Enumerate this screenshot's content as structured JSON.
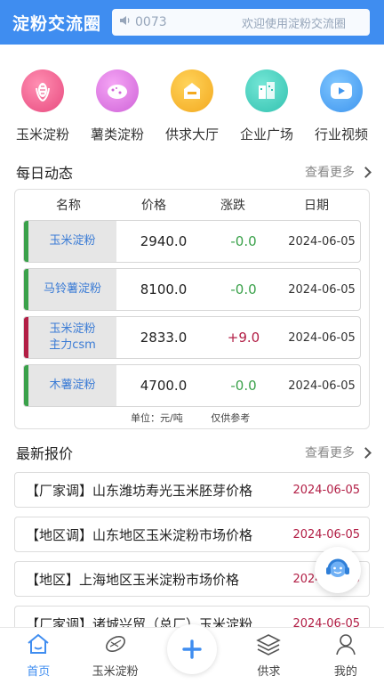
{
  "header": {
    "title": "淀粉交流圈",
    "notice_number": "0073",
    "notice_text": "欢迎使用淀粉交流圈"
  },
  "shortcuts": [
    {
      "label": "玉米淀粉",
      "icon": "corn-icon"
    },
    {
      "label": "薯类淀粉",
      "icon": "potato-icon"
    },
    {
      "label": "供求大厅",
      "icon": "hall-icon"
    },
    {
      "label": "企业广场",
      "icon": "buildings-icon"
    },
    {
      "label": "行业视频",
      "icon": "play-icon"
    }
  ],
  "daily": {
    "title": "每日动态",
    "more": "查看更多",
    "columns": [
      "名称",
      "价格",
      "涨跌",
      "日期"
    ],
    "rows": [
      {
        "name": "玉米淀粉",
        "price": "2940.0",
        "change": "-0.0",
        "date": "2024-06-05",
        "trend": "down"
      },
      {
        "name": "马铃薯淀粉",
        "price": "8100.0",
        "change": "-0.0",
        "date": "2024-06-05",
        "trend": "down"
      },
      {
        "name": "玉米淀粉\n主力csm",
        "name_line1": "玉米淀粉",
        "name_line2": "主力csm",
        "price": "2833.0",
        "change": "+9.0",
        "date": "2024-06-05",
        "trend": "up"
      },
      {
        "name": "木薯淀粉",
        "price": "4700.0",
        "change": "-0.0",
        "date": "2024-06-05",
        "trend": "down"
      }
    ],
    "unit": "单位：元/吨",
    "note": "仅供参考"
  },
  "quotes": {
    "title": "最新报价",
    "more": "查看更多",
    "items": [
      {
        "title": "【厂家调】山东潍坊寿光玉米胚芽价格",
        "date": "2024-06-05"
      },
      {
        "title": "【地区调】山东地区玉米淀粉市场价格",
        "date": "2024-06-05"
      },
      {
        "title": "【地区】上海地区玉米淀粉市场价格",
        "date": "2024-06-05"
      },
      {
        "title": "【厂家调】诸城兴贸（总厂）玉米淀粉",
        "date": "2024-06-05"
      }
    ]
  },
  "tabbar": [
    {
      "label": "首页",
      "icon": "home-icon",
      "active": true
    },
    {
      "label": "玉米淀粉",
      "icon": "corn-outline-icon",
      "active": false
    },
    {
      "label": "",
      "icon": "plus-icon",
      "active": false
    },
    {
      "label": "供求",
      "icon": "layers-icon",
      "active": false
    },
    {
      "label": "我的",
      "icon": "user-icon",
      "active": false
    }
  ],
  "colors": {
    "accent": "#3f8df0",
    "down": "#3aa14a",
    "up": "#b21e45"
  }
}
